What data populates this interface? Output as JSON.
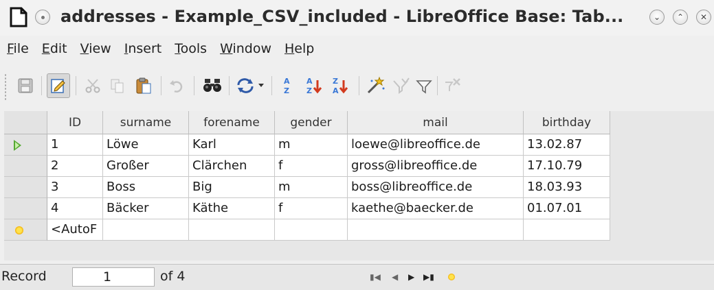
{
  "window": {
    "title": "addresses - Example_CSV_included - LibreOffice Base: Tab...",
    "controls": [
      "chevron-down-icon",
      "chevron-up-icon",
      "close-icon"
    ]
  },
  "menu": {
    "items": [
      {
        "label": "File",
        "mnemonic": "F",
        "rest": "ile"
      },
      {
        "label": "Edit",
        "mnemonic": "E",
        "rest": "dit"
      },
      {
        "label": "View",
        "mnemonic": "V",
        "rest": "iew"
      },
      {
        "label": "Insert",
        "mnemonic": "I",
        "rest": "nsert"
      },
      {
        "label": "Tools",
        "mnemonic": "T",
        "rest": "ools"
      },
      {
        "label": "Window",
        "mnemonic": "W",
        "rest": "indow"
      },
      {
        "label": "Help",
        "mnemonic": "H",
        "rest": "elp"
      }
    ]
  },
  "toolbar": {
    "icons": [
      "save-icon",
      "edit-mode-icon",
      "cut-icon",
      "copy-icon",
      "paste-icon",
      "undo-icon",
      "find-record-icon",
      "refresh-icon",
      "sort-icon",
      "sort-ascending-icon",
      "sort-descending-icon",
      "autofilter-icon",
      "standard-filter-icon",
      "apply-filter-icon",
      "remove-filter-icon"
    ],
    "sort_a": "A",
    "sort_z": "Z"
  },
  "table": {
    "columns": [
      "ID",
      "surname",
      "forename",
      "gender",
      "mail",
      "birthday"
    ],
    "rows": [
      [
        "1",
        "Löwe",
        "Karl",
        "m",
        "loewe@libreoffice.de",
        "13.02.87"
      ],
      [
        "2",
        "Großer",
        "Clärchen",
        "f",
        "gross@libreoffice.de",
        "17.10.79"
      ],
      [
        "3",
        "Boss",
        "Big",
        "m",
        "boss@libreoffice.de",
        "18.03.93"
      ],
      [
        "4",
        "Bäcker",
        "Käthe",
        "f",
        "kaethe@baecker.de",
        "01.07.01"
      ]
    ],
    "new_row": [
      "<AutoF",
      "",
      "",
      "",
      "",
      ""
    ],
    "current_row_marker": "current-record-arrow-icon",
    "new_row_marker": "new-record-star-icon"
  },
  "navigation": {
    "label": "Record",
    "current": "1",
    "of_text": "of 4",
    "buttons": [
      "first-record-icon",
      "previous-record-icon",
      "next-record-icon",
      "last-record-icon",
      "new-record-icon"
    ]
  },
  "colors": {
    "current_arrow": "#55a832",
    "new_record_star": "#f0a800",
    "sort_ascending": "#3a78d6",
    "sort_descending": "#d23a1e"
  }
}
